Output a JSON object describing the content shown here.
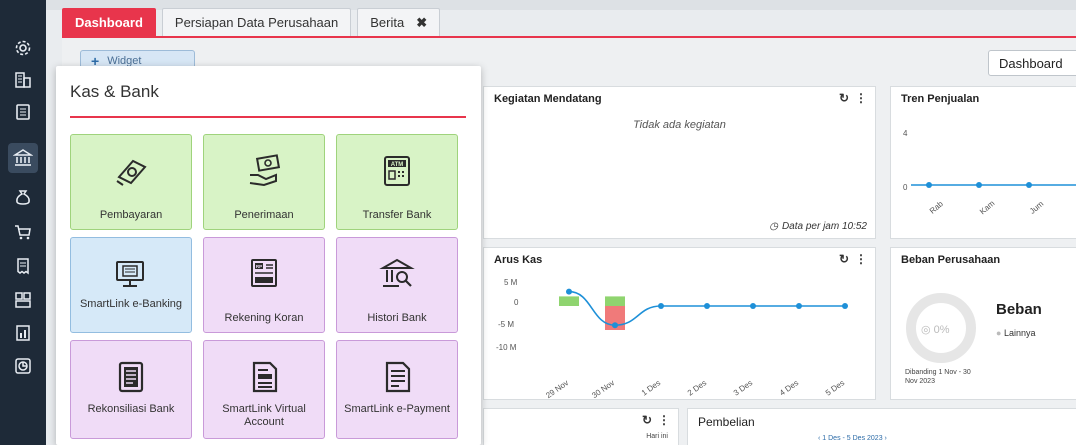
{
  "tabs": [
    {
      "label": "Dashboard",
      "active": true
    },
    {
      "label": "Persiapan Data Perusahaan",
      "active": false
    },
    {
      "label": "Berita",
      "active": false,
      "close": "✖"
    }
  ],
  "toolbar": {
    "widget_label": "Widget",
    "dashboard_select": "Dashboard"
  },
  "rail_icons": [
    "gear-icon",
    "building-icon",
    "document-icon",
    "bank-icon",
    "money-bag-icon",
    "cart-icon",
    "receipt-icon",
    "inventory-icon",
    "report-icon",
    "chart-icon"
  ],
  "panel": {
    "title": "Kas & Bank",
    "tiles": [
      {
        "label": "Pembayaran",
        "color": "green",
        "icon": "payment-icon"
      },
      {
        "label": "Penerimaan",
        "color": "green",
        "icon": "receive-money-icon"
      },
      {
        "label": "Transfer Bank",
        "color": "green",
        "icon": "atm-icon"
      },
      {
        "label": "SmartLink e-Banking",
        "color": "blue",
        "icon": "computer-bank-icon"
      },
      {
        "label": "Rekening Koran",
        "color": "purple",
        "icon": "statement-icon"
      },
      {
        "label": "Histori Bank",
        "color": "purple",
        "icon": "bank-search-icon"
      },
      {
        "label": "Rekonsiliasi Bank",
        "color": "purple",
        "icon": "reconcile-icon"
      },
      {
        "label": "SmartLink Virtual Account",
        "color": "purple",
        "icon": "virtual-account-icon"
      },
      {
        "label": "SmartLink e-Payment",
        "color": "purple",
        "icon": "e-payment-icon"
      }
    ]
  },
  "kegiatan": {
    "title": "Kegiatan Mendatang",
    "empty": "Tidak ada kegiatan",
    "data_per": "Data per jam 10:52"
  },
  "tren": {
    "title": "Tren Penjualan",
    "y_labels": [
      "4",
      "0"
    ],
    "x_labels": [
      "Rab",
      "Kam",
      "Jum"
    ]
  },
  "arus": {
    "title": "Arus Kas",
    "y_labels": [
      "5 M",
      "0",
      "-5 M",
      "-10 M"
    ],
    "x_labels": [
      "29 Nov",
      "30 Nov",
      "1 Des",
      "2 Des",
      "3 Des",
      "4 Des",
      "5 Des"
    ]
  },
  "beban": {
    "title": "Beban Perusahaan",
    "heading": "Beban",
    "pct": "0%",
    "legend": "Lainnya",
    "note": "Dibanding 1 Nov - 30 Nov 2023"
  },
  "bottom_left": {
    "hari_ini": "Hari ini"
  },
  "pembelian": {
    "title": "Pembelian",
    "range": "1 Des - 5 Des 2023"
  },
  "chart_data": [
    {
      "type": "line",
      "title": "Arus Kas",
      "categories": [
        "29 Nov",
        "30 Nov",
        "1 Des",
        "2 Des",
        "3 Des",
        "4 Des",
        "5 Des"
      ],
      "series": [
        {
          "values": [
            3,
            -4,
            0,
            0,
            0,
            0,
            0
          ]
        }
      ],
      "bars_in": [
        2,
        0,
        0,
        0,
        0,
        0,
        0
      ],
      "bars_in_30nov": 2,
      "bars_out_30nov": -5,
      "ylim": [
        -10,
        5
      ],
      "colors": {
        "line": "#1e90d8",
        "in": "#8fd46f",
        "out": "#f07a7a"
      }
    },
    {
      "type": "line",
      "title": "Tren Penjualan",
      "categories": [
        "Rab",
        "Kam",
        "Jum"
      ],
      "series": [
        {
          "values": [
            0,
            0,
            0
          ]
        }
      ],
      "ylim": [
        0,
        4
      ]
    }
  ]
}
